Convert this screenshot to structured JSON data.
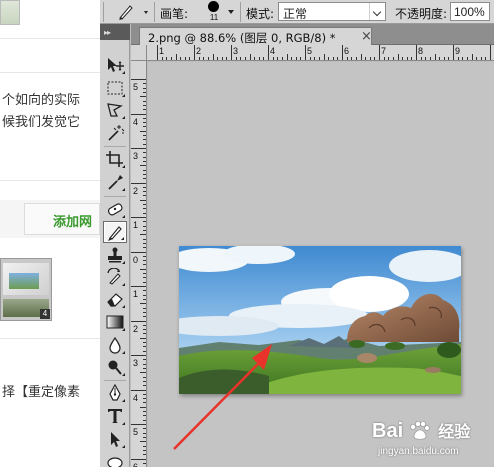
{
  "webpage": {
    "line1": "个如向的实际",
    "line2": "候我们发觉它",
    "add_button": "添加网",
    "line3": "择【重定像素"
  },
  "options_bar": {
    "brush_label": "画笔:",
    "brush_size": "11",
    "mode_label": "模式:",
    "mode_value": "正常",
    "opacity_label": "不透明度:",
    "opacity_value": "100%"
  },
  "document": {
    "tab_title": "2.png @ 88.6% (图层 0, RGB/8) *",
    "close_glyph": "×"
  },
  "rulers": {
    "horizontal": [
      "1",
      "2",
      "3",
      "4",
      "5",
      "6",
      "7",
      "8",
      "9"
    ],
    "vertical": [
      "5",
      "4",
      "3",
      "2",
      "1",
      "0",
      "1",
      "2",
      "3",
      "4",
      "5",
      "6"
    ]
  },
  "toolbox": {
    "tools": [
      "move-tool",
      "marquee-tool",
      "lasso-tool",
      "magic-wand-tool",
      "crop-tool",
      "eyedropper-tool",
      "healing-brush-tool",
      "brush-tool",
      "clone-stamp-tool",
      "history-brush-tool",
      "eraser-tool",
      "gradient-tool",
      "blur-tool",
      "dodge-tool",
      "pen-tool",
      "type-tool",
      "path-selection-tool",
      "shape-tool"
    ],
    "active_tool": "brush-tool"
  },
  "watermark": {
    "logo_left": "Bai",
    "logo_right": "经验",
    "url": "jingyan.baidu.com"
  },
  "colors": {
    "arrow": "#e8322a",
    "ui_grey": "#d6d6d6",
    "canvas_bg": "#c4c4c4",
    "add_button_text": "#3a9a2e"
  }
}
